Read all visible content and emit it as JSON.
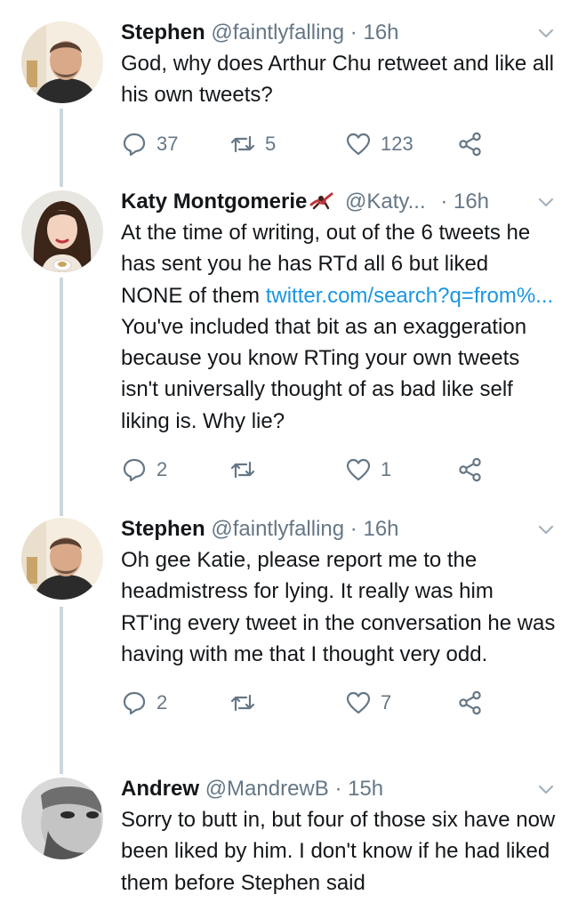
{
  "tweets": [
    {
      "name": "Stephen",
      "handle": "@faintlyfalling",
      "dot": "·",
      "time": "16h",
      "text": "God, why does Arthur Chu retweet and like all his own tweets?",
      "replies": "37",
      "retweets": "5",
      "likes": "123"
    },
    {
      "name": "Katy Montgomerie",
      "handle": "@Katy...",
      "dot": "·",
      "time": "16h",
      "text_1": "At the time of writing, out of the 6 tweets he has sent you he has RTd all 6 but liked NONE of them ",
      "link": "twitter.com/search?q=from%...",
      "text_2": " You've included that bit as an exaggeration because you know RTing your own tweets isn't universally thought of as bad like self liking is. Why lie?",
      "replies": "2",
      "retweets": "",
      "likes": "1"
    },
    {
      "name": "Stephen",
      "handle": "@faintlyfalling",
      "dot": "·",
      "time": "16h",
      "text": "Oh gee Katie, please report me to the headmistress for lying. It really was him RT'ing every tweet in the conversation he was having with me that I thought very odd.",
      "replies": "2",
      "retweets": "",
      "likes": "7"
    },
    {
      "name": "Andrew",
      "handle": "@MandrewB",
      "dot": "·",
      "time": "15h",
      "text": "Sorry to butt in, but four of those six have now been liked by him. I don't know if he had liked them before Stephen said"
    }
  ],
  "colors": {
    "text": "#14171a",
    "secondary": "#657786",
    "link": "#1b95e0",
    "thread_line": "#ccd6dd"
  },
  "icons": {
    "reply": "reply-icon",
    "retweet": "retweet-icon",
    "like": "heart-icon",
    "share": "share-icon",
    "menu": "chevron-down-icon"
  }
}
